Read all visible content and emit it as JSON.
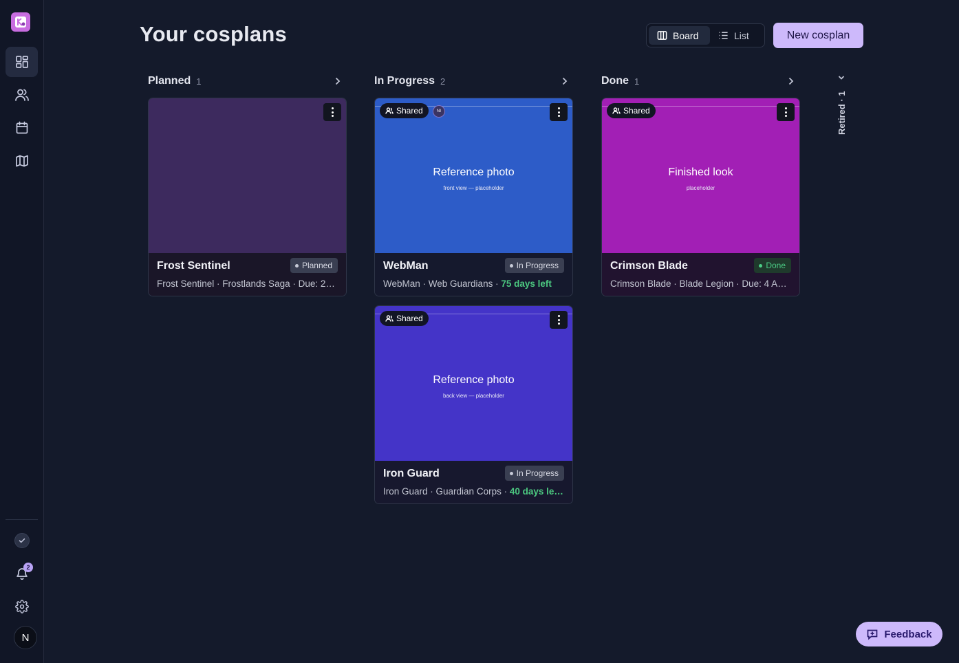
{
  "header": {
    "title": "Your cosplans",
    "view_board": "Board",
    "view_list": "List",
    "new_button": "New cosplan"
  },
  "sidebar": {
    "items": [
      {
        "icon": "dashboard-icon",
        "active": true
      },
      {
        "icon": "users-icon",
        "active": false
      },
      {
        "icon": "calendar-icon",
        "active": false
      },
      {
        "icon": "map-icon",
        "active": false
      }
    ],
    "notification_count": "2",
    "user_initial": "N"
  },
  "columns": [
    {
      "title": "Planned",
      "count": "1"
    },
    {
      "title": "In Progress",
      "count": "2"
    },
    {
      "title": "Done",
      "count": "1"
    }
  ],
  "retired": {
    "label": "Retired · 1"
  },
  "cards": {
    "frost": {
      "name": "Frost Sentinel",
      "status": "Planned",
      "meta": "Frost Sentinel · Frostlands Saga · Due: 2…",
      "color": "#3d2a5e"
    },
    "webman": {
      "shared": "Shared",
      "avatar": "NI",
      "media_title": "Reference photo",
      "media_sub": "front view — placeholder",
      "name": "WebMan",
      "status": "In Progress",
      "meta": "WebMan · Web Guardians · ",
      "days": "75 days left",
      "color": "#2d5cc8"
    },
    "crimson": {
      "shared": "Shared",
      "media_title": "Finished look",
      "media_sub": "placeholder",
      "name": "Crimson Blade",
      "status": "Done",
      "meta": "Crimson Blade · Blade Legion · Due: 4 A…",
      "color": "#a21fb5"
    },
    "iron": {
      "shared": "Shared",
      "media_title": "Reference photo",
      "media_sub": "back view — placeholder",
      "name": "Iron Guard",
      "status": "In Progress",
      "meta": "Iron Guard · Guardian Corps · ",
      "days": "40 days le…",
      "color": "#4434c8"
    }
  },
  "feedback_label": "Feedback"
}
